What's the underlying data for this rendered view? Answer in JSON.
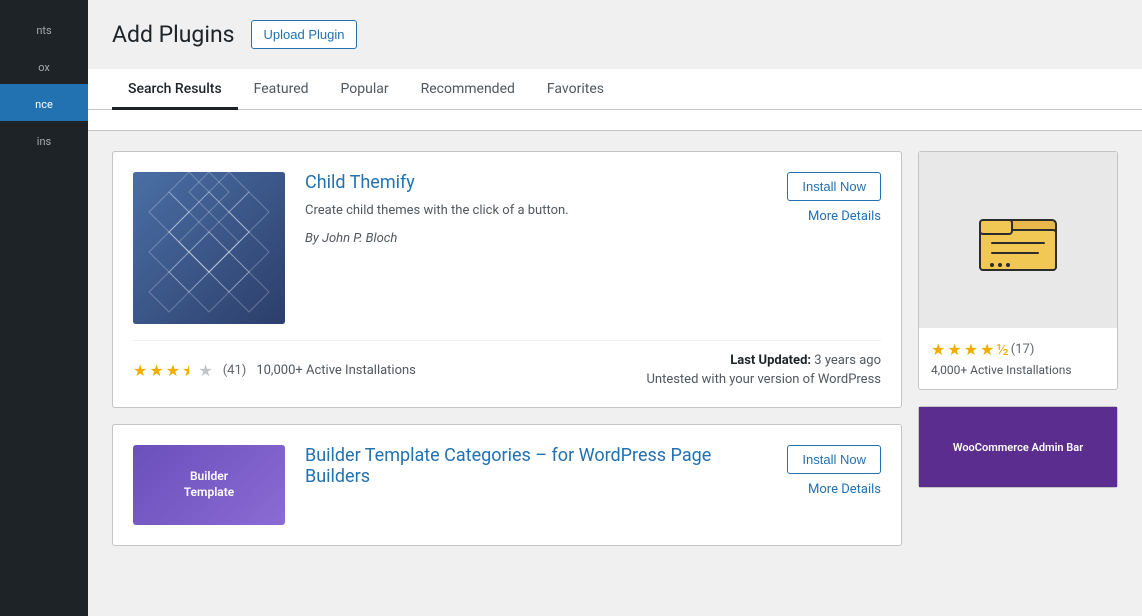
{
  "sidebar": {
    "items": [
      {
        "label": "nts",
        "active": false
      },
      {
        "label": "ox",
        "active": false
      },
      {
        "label": "nce",
        "active": true
      },
      {
        "label": "ins",
        "active": false
      }
    ]
  },
  "page": {
    "title": "Add Plugins",
    "upload_button": "Upload Plugin"
  },
  "tabs": {
    "items": [
      {
        "label": "Search Results",
        "active": true
      },
      {
        "label": "Featured",
        "active": false
      },
      {
        "label": "Popular",
        "active": false
      },
      {
        "label": "Recommended",
        "active": false
      },
      {
        "label": "Favorites",
        "active": false
      }
    ]
  },
  "plugins": [
    {
      "name": "Child Themify",
      "description": "Create child themes with the click of a button.",
      "author": "By John P. Bloch",
      "install_label": "Install Now",
      "more_details_label": "More Details",
      "rating": 3.5,
      "rating_count": "(41)",
      "active_installs": "10,000+ Active Installations",
      "last_updated_label": "Last Updated:",
      "last_updated_value": "3 years ago",
      "untested": "Untested with your version of WordPress"
    },
    {
      "name": "Builder Template Categories – for WordPress Page Builders",
      "description": "",
      "author": "",
      "install_label": "Install Now",
      "more_details_label": "More Details",
      "rating": 0,
      "rating_count": "",
      "active_installs": "",
      "last_updated_label": "",
      "last_updated_value": "",
      "untested": ""
    }
  ],
  "right_plugins": [
    {
      "rating": 4.5,
      "rating_count": "(17)",
      "active_installs": "4,000+ Active Installations"
    },
    {
      "thumb_label": "WooCommerce Admin Bar"
    }
  ]
}
